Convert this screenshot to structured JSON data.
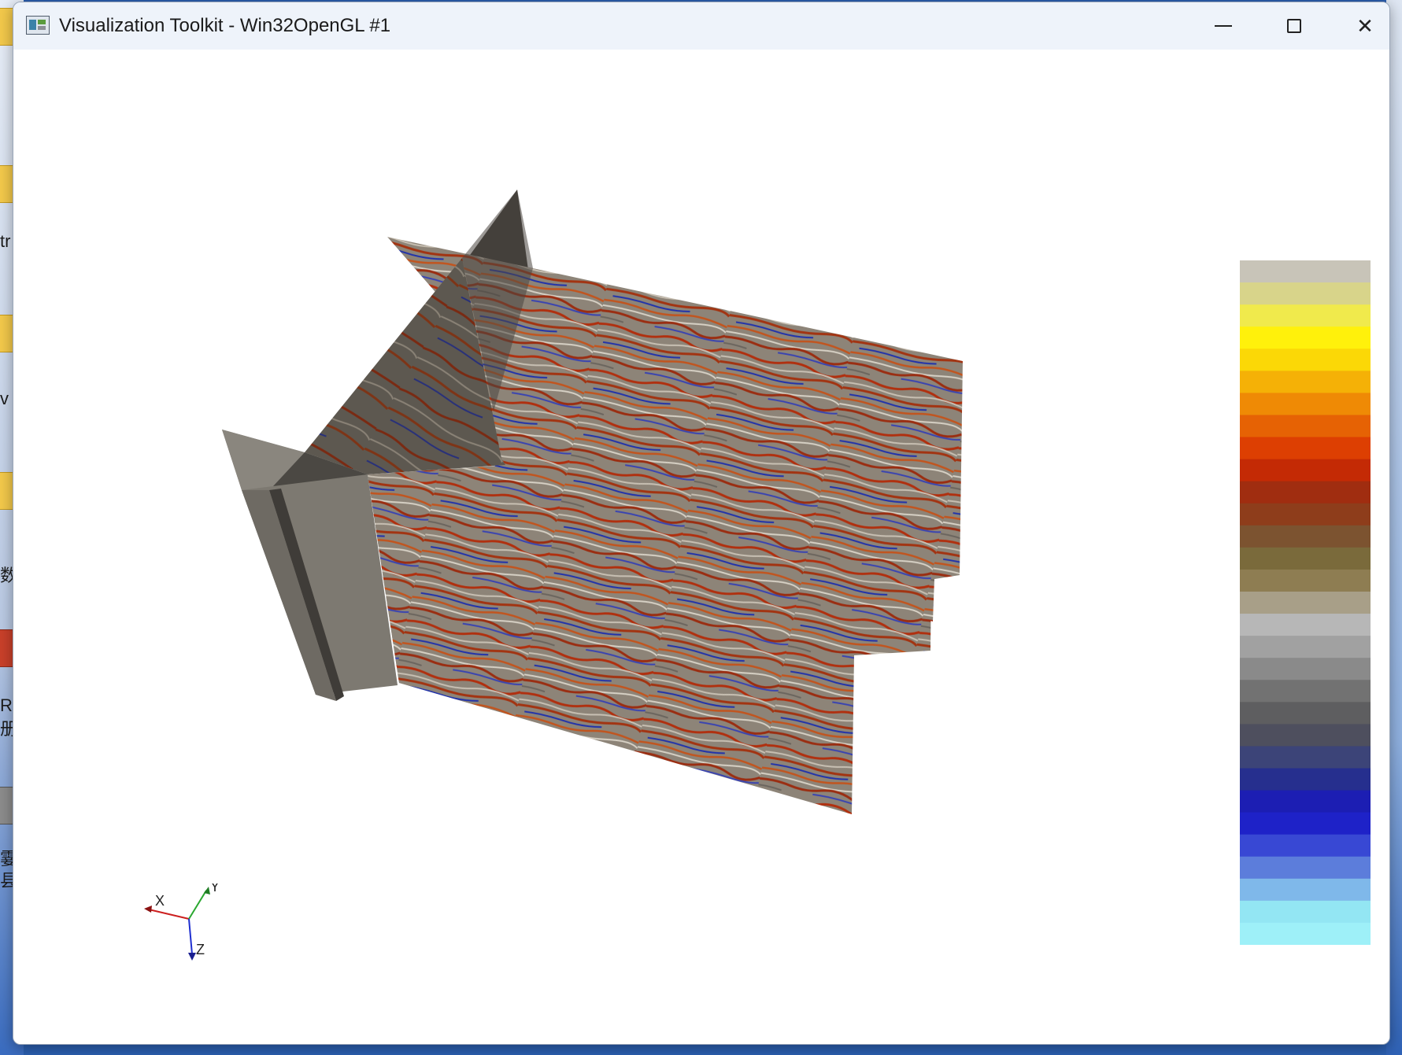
{
  "window": {
    "title": "Visualization Toolkit - Win32OpenGL #1",
    "app_icon": "vtk-app-icon",
    "controls": {
      "minimize_icon": "minimize-icon",
      "maximize_icon": "maximize-icon",
      "close_icon": "close-icon",
      "close_glyph": "✕"
    }
  },
  "desktop_edge_text": [
    "tr",
    "v",
    "数",
    "R",
    "册",
    "霎",
    "县"
  ],
  "orientation_axes": {
    "x_label": "X",
    "y_label": "Y",
    "z_label": "Z"
  },
  "colors": {
    "background": "#ffffff",
    "fault_plane": "#7d7971",
    "axis_x": "#cc1f1f",
    "axis_y": "#2aa830",
    "axis_z": "#1f2fd0",
    "colormap": [
      "#9ef0f8",
      "#93e6f3",
      "#7fb8ea",
      "#5c7ddb",
      "#3848d4",
      "#1e22c8",
      "#1c1eb3",
      "#262f8e",
      "#3c4478",
      "#4e4f5e",
      "#5e5e60",
      "#727272",
      "#8a8a8a",
      "#a1a1a1",
      "#b7b7b7",
      "#a89f88",
      "#8e7d52",
      "#7a6a3b",
      "#7c5330",
      "#8e3d1b",
      "#a02d10",
      "#c42a05",
      "#dd3f02",
      "#e66204",
      "#ef8a05",
      "#f5b106",
      "#fbd806",
      "#fff10b",
      "#f0ea4c",
      "#d8d48a",
      "#c8c4b8"
    ]
  }
}
